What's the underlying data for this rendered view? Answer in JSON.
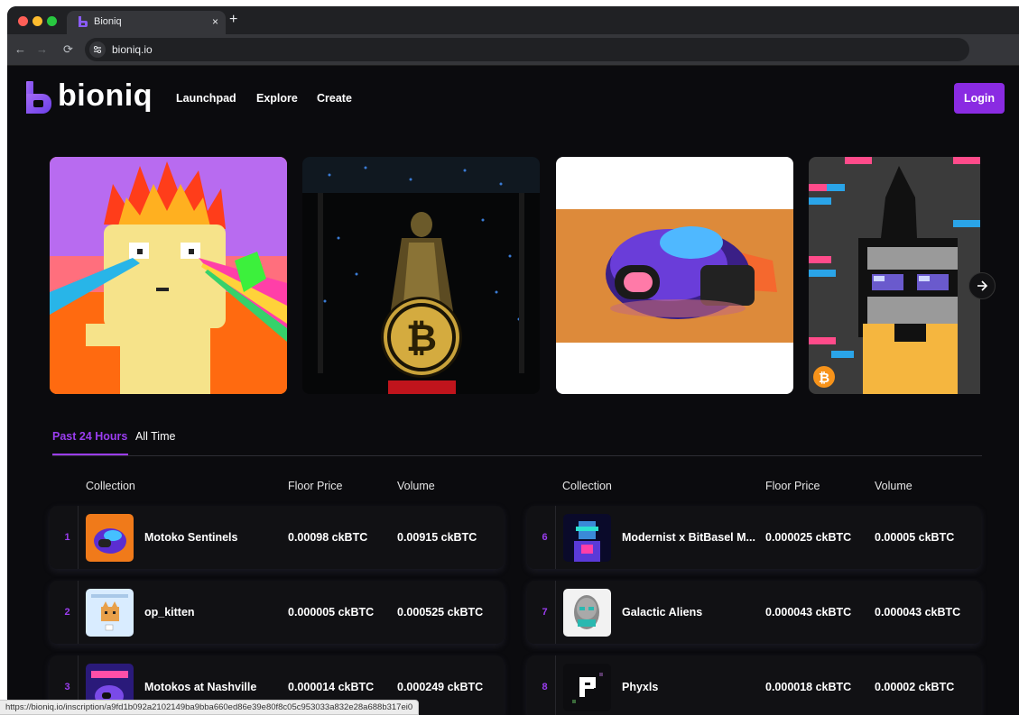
{
  "browser": {
    "tab_title": "Bioniq",
    "tab_close": "×",
    "new_tab": "+",
    "url": "bioniq.io",
    "status_url": "https://bioniq.io/inscription/a9fd1b092a2102149ba9bba660ed86e39e80f8c05c953033a832e28a688b317ei0"
  },
  "header": {
    "logo_text": "bioniq",
    "nav": [
      "Launchpad",
      "Explore",
      "Create"
    ],
    "login_label": "Login",
    "accent_color": "#8a2be2"
  },
  "carousel": {
    "card_icons": [
      "fire-pixel-creature-art",
      "bitcoin-statue-art",
      "purple-sneaker-art",
      "pixel-punk-art"
    ],
    "next_icon": "arrow-right-icon"
  },
  "tabs": {
    "active": "Past 24 Hours",
    "other": "All Time"
  },
  "table": {
    "columns": [
      "Collection",
      "Floor Price",
      "Volume"
    ],
    "left_rows": [
      {
        "rank": "1",
        "name": "Motoko Sentinels",
        "floor": "0.00098 ckBTC",
        "volume": "0.00915 ckBTC"
      },
      {
        "rank": "2",
        "name": "op_kitten",
        "floor": "0.000005 ckBTC",
        "volume": "0.000525 ckBTC"
      },
      {
        "rank": "3",
        "name": "Motokos at Nashville",
        "floor": "0.000014 ckBTC",
        "volume": "0.000249 ckBTC"
      }
    ],
    "right_rows": [
      {
        "rank": "6",
        "name": "Modernist x BitBasel M...",
        "floor": "0.000025 ckBTC",
        "volume": "0.00005 ckBTC"
      },
      {
        "rank": "7",
        "name": "Galactic Aliens",
        "floor": "0.000043 ckBTC",
        "volume": "0.000043 ckBTC"
      },
      {
        "rank": "8",
        "name": "Phyxls",
        "floor": "0.000018 ckBTC",
        "volume": "0.00002 ckBTC"
      }
    ]
  }
}
